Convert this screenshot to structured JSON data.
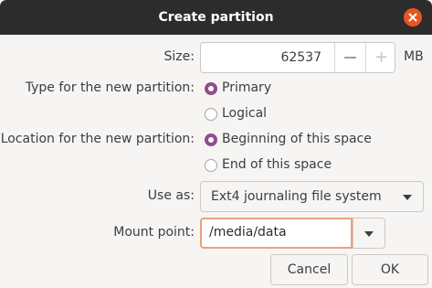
{
  "window": {
    "title": "Create partition",
    "accent_color": "#e95420",
    "radio_color": "#924d8b"
  },
  "size": {
    "label": "Size:",
    "value": "62537",
    "decrement": "—",
    "increment": "+",
    "unit": "MB"
  },
  "type": {
    "label": "Type for the new partition:",
    "options": [
      {
        "label": "Primary",
        "selected": true
      },
      {
        "label": "Logical",
        "selected": false
      }
    ]
  },
  "location": {
    "label": "Location for the new partition:",
    "options": [
      {
        "label": "Beginning of this space",
        "selected": true
      },
      {
        "label": "End of this space",
        "selected": false
      }
    ]
  },
  "use_as": {
    "label": "Use as:",
    "value": "Ext4 journaling file system"
  },
  "mount": {
    "label": "Mount point:",
    "value": "/media/data"
  },
  "buttons": {
    "cancel": "Cancel",
    "ok": "OK"
  }
}
